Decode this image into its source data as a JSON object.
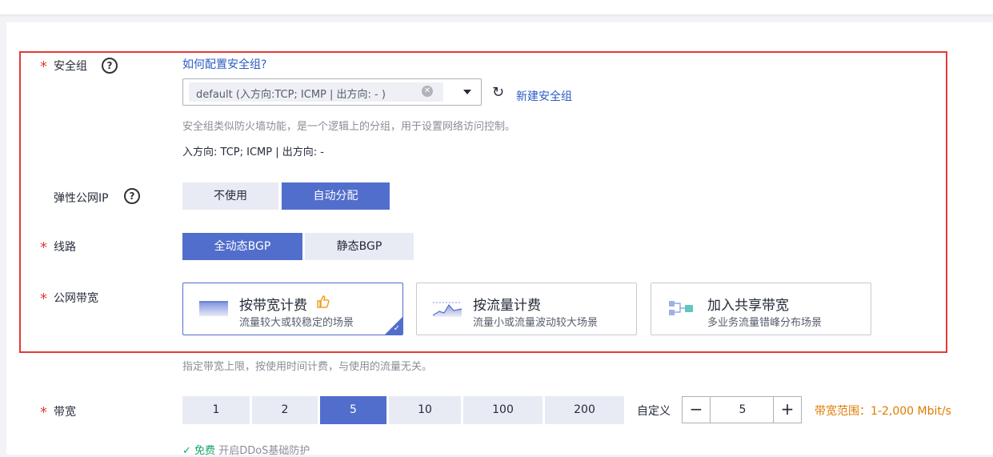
{
  "security_group": {
    "label": "安全组",
    "help_link": "如何配置安全组?",
    "selected_tag": "default (入方向:TCP; ICMP | 出方向: - )",
    "create_link": "新建安全组",
    "hint": "安全组类似防火墙功能，是一个逻辑上的分组，用于设置网络访问控制。",
    "rules": "入方向: TCP; ICMP | 出方向: -"
  },
  "eip": {
    "label": "弹性公网IP",
    "options": [
      "不使用",
      "自动分配"
    ],
    "selected": "自动分配"
  },
  "line": {
    "label": "线路",
    "options": [
      "全动态BGP",
      "静态BGP"
    ],
    "selected": "全动态BGP"
  },
  "public_bandwidth": {
    "label": "公网带宽",
    "cards": [
      {
        "title": "按带宽计费",
        "desc": "流量较大或较稳定的场景",
        "icon": "bandwidth-billing-icon",
        "selected": true
      },
      {
        "title": "按流量计费",
        "desc": "流量小或流量波动较大场景",
        "icon": "traffic-billing-icon",
        "selected": false
      },
      {
        "title": "加入共享带宽",
        "desc": "多业务流量错峰分布场景",
        "icon": "shared-bandwidth-icon",
        "selected": false
      }
    ],
    "hint": "指定带宽上限，按使用时间计费，与使用的流量无关。"
  },
  "bandwidth": {
    "label": "带宽",
    "options": [
      "1",
      "2",
      "5",
      "10",
      "100",
      "200"
    ],
    "selected": "5",
    "custom_label": "自定义",
    "custom_value": "5",
    "range_text": "带宽范围：1-2,000 Mbit/s",
    "ddos_free": "免费",
    "ddos_text": "开启DDoS基础防护"
  },
  "colors": {
    "accent": "#526ecc",
    "required": "#e53935",
    "link": "#2a5bc4",
    "warning": "#e07b00"
  }
}
